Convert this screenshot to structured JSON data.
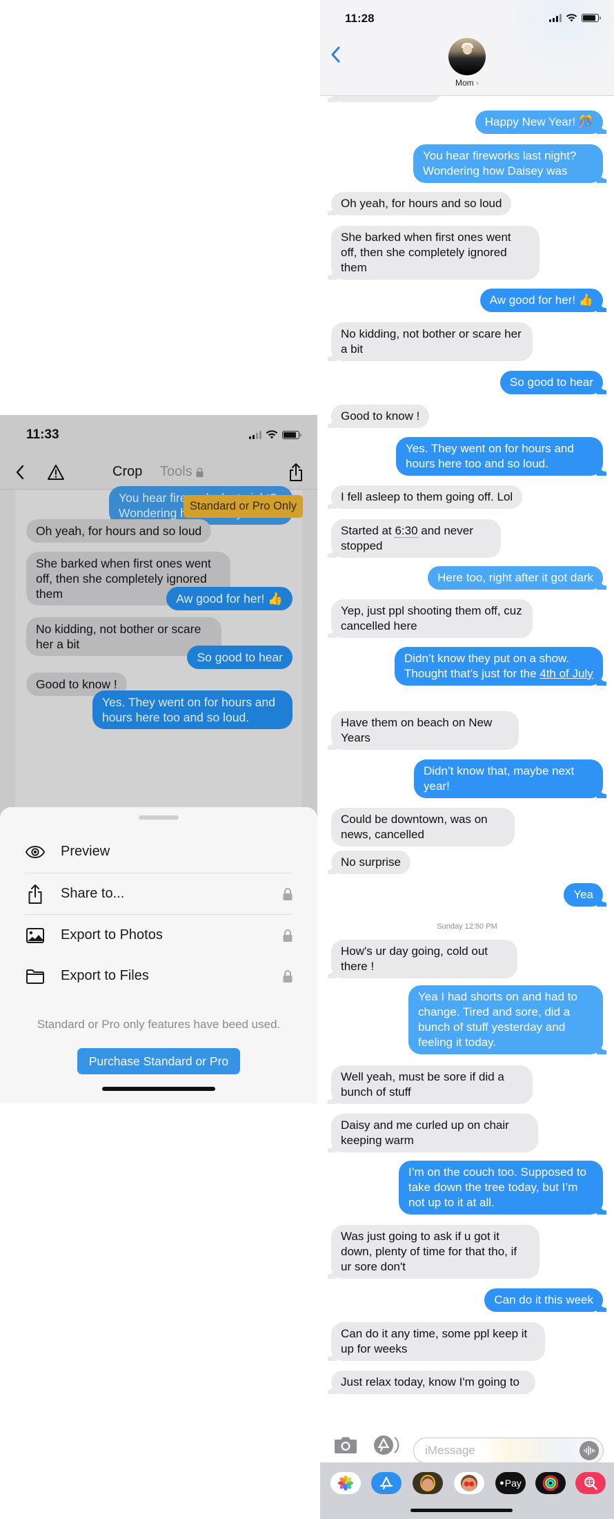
{
  "left_app": {
    "status_bar": {
      "time": "11:33"
    },
    "toolbar": {
      "back_icon": "chevron-left-icon",
      "warning_icon": "warning-triangle-icon",
      "tab_crop": "Crop",
      "tab_tools": "Tools",
      "tools_locked_icon": "lock-icon",
      "share_icon": "share-icon"
    },
    "preview_messages": [
      {
        "dir": "out",
        "text": "You hear fireworks last night? Wondering how Daisey was"
      },
      {
        "dir": "in",
        "text": "Oh yeah, for hours and so loud"
      },
      {
        "dir": "in",
        "text": "She barked when first ones went off, then she completely ignored them"
      },
      {
        "dir": "out",
        "text": "Aw good for her! 👍"
      },
      {
        "dir": "in",
        "text": "No kidding, not bother or scare her a bit"
      },
      {
        "dir": "out",
        "text": "So good to hear"
      },
      {
        "dir": "in",
        "text": "Good to know !"
      },
      {
        "dir": "out",
        "text": "Yes. They went on for hours and hours here too and so loud."
      }
    ],
    "badge": "Standard or Pro Only",
    "sheet": {
      "items": [
        {
          "label": "Preview",
          "icon": "eye-icon",
          "locked": false
        },
        {
          "label": "Share to...",
          "icon": "share-icon",
          "locked": true
        },
        {
          "label": "Export to Photos",
          "icon": "photo-icon",
          "locked": true
        },
        {
          "label": "Export to Files",
          "icon": "folder-icon",
          "locked": true
        }
      ],
      "note": "Standard or Pro only features have beed used.",
      "purchase_label": "Purchase Standard or Pro"
    }
  },
  "messages_app": {
    "status_bar": {
      "time": "11:28"
    },
    "header": {
      "contact_name": "Mom",
      "chevron": "›"
    },
    "thread": [
      {
        "dir": "out",
        "text": "Happy New Year! 🎊"
      },
      {
        "dir": "out",
        "text": "You hear fireworks last night? Wondering how Daisey was"
      },
      {
        "dir": "in",
        "text": "Oh yeah, for hours and so loud"
      },
      {
        "dir": "in",
        "text": "She barked when first ones went off, then she completely ignored them"
      },
      {
        "dir": "out",
        "text": "Aw good for her! 👍"
      },
      {
        "dir": "in",
        "text": "No kidding, not bother or scare her a bit"
      },
      {
        "dir": "out",
        "text": "So good to hear"
      },
      {
        "dir": "in",
        "text": "Good to know !"
      },
      {
        "dir": "out",
        "text": "Yes. They went on for hours and hours here too and so loud."
      },
      {
        "dir": "in",
        "text": "I fell asleep to them going off. Lol"
      },
      {
        "dir": "in",
        "text_before": "Started at ",
        "text_link": "6:30",
        "text_after": " and never stopped"
      },
      {
        "dir": "out",
        "text": "Here too, right after it got dark"
      },
      {
        "dir": "in",
        "text": "Yep, just ppl shooting them off, cuz cancelled here"
      },
      {
        "dir": "out",
        "text_before": "Didn’t know they put on a show. Thought that’s just for the ",
        "text_link": "4th of July",
        "text_after": ""
      },
      {
        "dir": "in",
        "text": "Have them on beach on New Years"
      },
      {
        "dir": "out",
        "text": "Didn’t know that, maybe next year!"
      },
      {
        "dir": "in",
        "text": "Could be downtown, was on news, cancelled"
      },
      {
        "dir": "in",
        "text": "No surprise"
      },
      {
        "dir": "out",
        "text": "Yea"
      },
      {
        "dir": "in",
        "text": "How's ur day going, cold out there !"
      },
      {
        "dir": "out",
        "text": "Yea I had shorts on and had to change. Tired and sore, did a bunch of stuff yesterday and feeling it today."
      },
      {
        "dir": "in",
        "text": "Well yeah, must be sore if did a bunch of stuff"
      },
      {
        "dir": "in",
        "text": "Daisy and me curled up on chair keeping warm"
      },
      {
        "dir": "out",
        "text": "I’m on the couch too. Supposed to take down the tree today, but I’m not up to it at all."
      },
      {
        "dir": "in",
        "text": "Was just going to ask if u got it down, plenty of time for that tho, if ur sore don't"
      },
      {
        "dir": "out",
        "text": "Can do it this week"
      },
      {
        "dir": "in",
        "text": "Can do it any time, some ppl keep it up for weeks"
      },
      {
        "dir": "in",
        "text": "Just relax today, know I'm going to"
      }
    ],
    "timestamp": "Sunday 12:50 PM",
    "compose": {
      "placeholder": "iMessage",
      "camera_icon": "camera-icon",
      "apps_icon": "app-store-icon",
      "audio_icon": "audio-waveform-icon"
    },
    "app_drawer": [
      {
        "name": "photos-app-icon"
      },
      {
        "name": "app-store-app-icon"
      },
      {
        "name": "memoji-camera-app-icon"
      },
      {
        "name": "memoji-stickers-app-icon"
      },
      {
        "name": "apple-pay-app-icon",
        "label": "Pay"
      },
      {
        "name": "activity-app-icon"
      },
      {
        "name": "image-search-app-icon"
      }
    ]
  },
  "colors": {
    "imessage_blue": "#2f93f5",
    "incoming_gray": "#e9e9eb",
    "badge_gold": "#d4a02c",
    "purchase_blue": "#3594e6",
    "ios_link_blue": "#1a7ee0"
  }
}
